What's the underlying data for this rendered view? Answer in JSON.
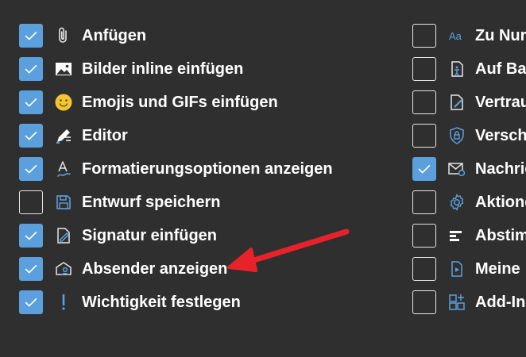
{
  "left_items": [
    {
      "label": "Anfügen",
      "checked": true,
      "icon": "paperclip-icon"
    },
    {
      "label": "Bilder inline einfügen",
      "checked": true,
      "icon": "image-icon"
    },
    {
      "label": "Emojis und GIFs einfügen",
      "checked": true,
      "icon": "emoji-icon"
    },
    {
      "label": "Editor",
      "checked": true,
      "icon": "editor-pen-icon"
    },
    {
      "label": "Formatierungsoptionen anzeigen",
      "checked": true,
      "icon": "format-text-icon"
    },
    {
      "label": "Entwurf speichern",
      "checked": false,
      "icon": "save-icon"
    },
    {
      "label": "Signatur einfügen",
      "checked": true,
      "icon": "signature-icon"
    },
    {
      "label": "Absender anzeigen",
      "checked": true,
      "icon": "sender-icon"
    },
    {
      "label": "Wichtigkeit festlegen",
      "checked": true,
      "icon": "importance-icon"
    }
  ],
  "right_items": [
    {
      "label": "Zu Nur",
      "checked": false,
      "icon": "text-aa-icon"
    },
    {
      "label": "Auf Bar",
      "checked": false,
      "icon": "accessibility-check-icon"
    },
    {
      "label": "Vertrau",
      "checked": false,
      "icon": "sensitivity-icon"
    },
    {
      "label": "Verschl",
      "checked": false,
      "icon": "encrypt-shield-icon"
    },
    {
      "label": "Nachric",
      "checked": true,
      "icon": "message-options-icon"
    },
    {
      "label": "Aktione",
      "checked": false,
      "icon": "gear-icon"
    },
    {
      "label": "Abstim",
      "checked": false,
      "icon": "poll-icon"
    },
    {
      "label": "Meine",
      "checked": false,
      "icon": "my-templates-icon"
    },
    {
      "label": "Add-In",
      "checked": false,
      "icon": "add-ins-grid-icon"
    }
  ],
  "colors": {
    "background": "#2f2f2f",
    "accent": "#5ba0dc",
    "arrow": "#e8222b",
    "text": "#ffffff"
  }
}
